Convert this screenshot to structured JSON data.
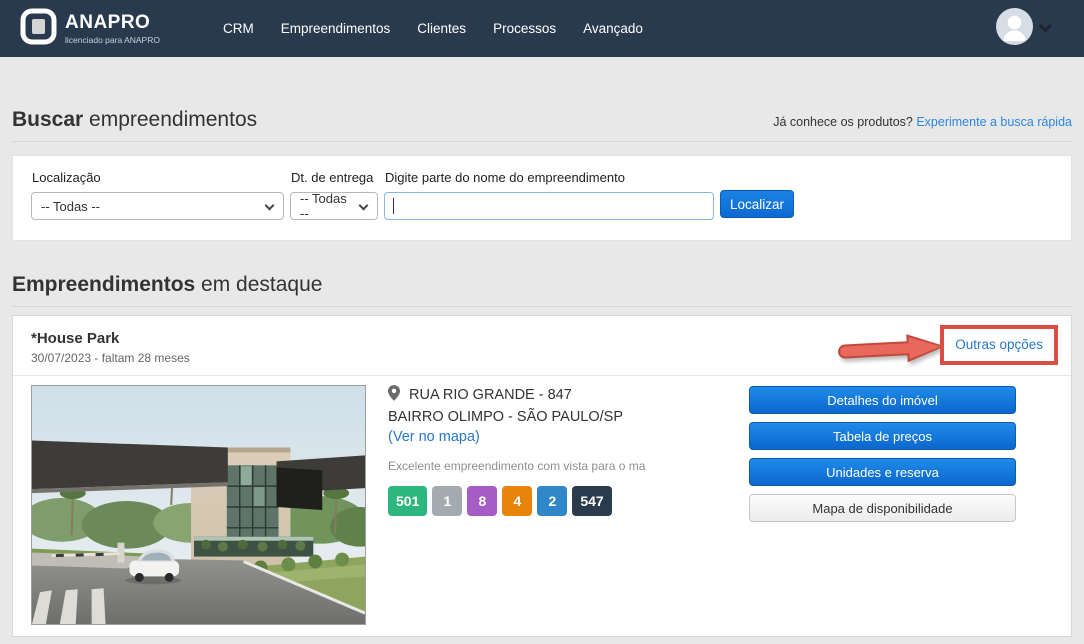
{
  "navbar": {
    "brand": {
      "name": "ANAPRO",
      "subtitle": "licenciado para ANAPRO"
    },
    "menu": [
      {
        "label": "CRM"
      },
      {
        "label": "Empreendimentos"
      },
      {
        "label": "Clientes"
      },
      {
        "label": "Processos"
      },
      {
        "label": "Avançado"
      }
    ],
    "bg_color": "#293A4E"
  },
  "search_section": {
    "title_bold": "Buscar",
    "title_rest": " empreendimentos",
    "hint_text": "Já conhece os produtos? ",
    "hint_link": "Experimente a busca rápida",
    "form": {
      "location_label": "Localização",
      "location_value": "-- Todas --",
      "delivery_label": "Dt. de entrega",
      "delivery_value": "-- Todas --",
      "name_label": "Digite parte do nome do empreendimento",
      "name_value": "",
      "submit_label": "Localizar"
    }
  },
  "featured_section": {
    "title_bold": "Empreendimentos",
    "title_rest": " em destaque",
    "card": {
      "name": "*House Park",
      "date_info": "30/07/2023 - faltam 28 meses",
      "other_options_link": "Outras opções",
      "address_line1": "RUA RIO GRANDE - 847",
      "address_line2": "BAIRRO OLIMPO - SÃO PAULO/SP",
      "map_link": "(Ver no mapa)",
      "description": "Excelente empreendimento com vista para o ma",
      "badges": [
        {
          "value": "501",
          "color": "#2DB67D"
        },
        {
          "value": "1",
          "color": "#A4ABAE"
        },
        {
          "value": "8",
          "color": "#A55CC5"
        },
        {
          "value": "4",
          "color": "#E8830C"
        },
        {
          "value": "2",
          "color": "#2F86C8"
        },
        {
          "value": "547",
          "color": "#2A3B4E"
        }
      ],
      "buttons": [
        {
          "label": "Detalhes do imóvel",
          "style": "primary"
        },
        {
          "label": "Tabela de preços",
          "style": "primary"
        },
        {
          "label": "Unidades e reserva",
          "style": "primary"
        },
        {
          "label": "Mapa de disponibilidade",
          "style": "light"
        }
      ]
    }
  },
  "colors": {
    "accent_blue": "#1373D2",
    "link_blue": "#2878C8",
    "annotation_red": "#D94F44",
    "page_bg": "#E9E8E8"
  }
}
